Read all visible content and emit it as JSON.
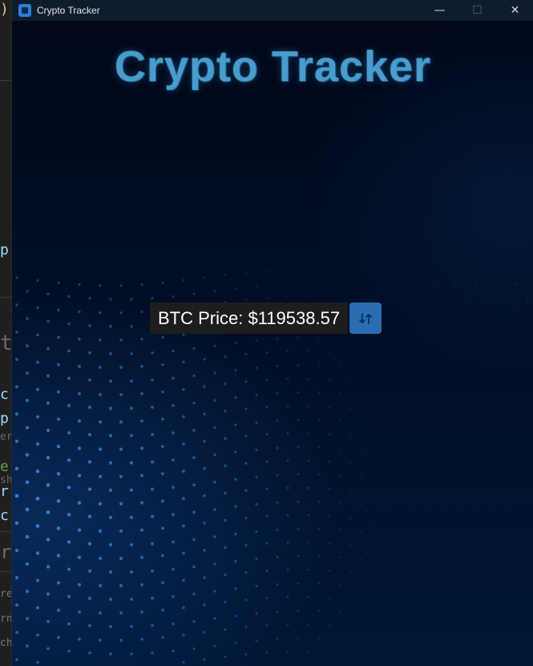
{
  "background_editor": {
    "fragments": [
      ")",
      "p",
      "t",
      "c",
      "p",
      "er",
      "e",
      "sh",
      "r",
      "c",
      "r",
      "re",
      "rn",
      "ch"
    ]
  },
  "window": {
    "title": "Crypto Tracker",
    "icon": "app-window-icon",
    "controls": {
      "minimize_glyph": "—",
      "maximize_glyph": "☐",
      "close_glyph": "✕"
    }
  },
  "main": {
    "heading": "Crypto Tracker",
    "price_label": "BTC Price: $119538.57",
    "refresh_icon": "refresh-icon"
  },
  "colors": {
    "background": "#000d22",
    "heading": "#4a9ccc",
    "button": "#2a6db3",
    "price_box": "#1d1d1d"
  }
}
